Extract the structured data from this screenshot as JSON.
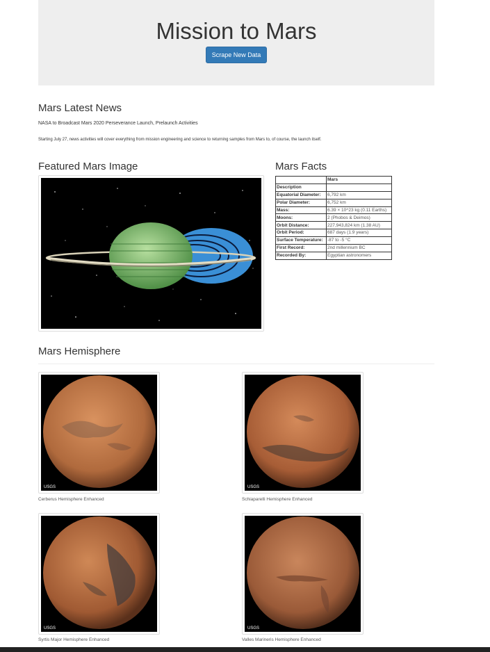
{
  "header": {
    "title": "Mission to Mars",
    "scrape_button_label": "Scrape New Data"
  },
  "news": {
    "heading": "Mars Latest News",
    "title": "NASA to Broadcast Mars 2020 Perseverance Launch, Prelaunch Activities",
    "paragraph": "Starting July 27, news activities will cover everything from mission engineering and science to returning samples from Mars to, of course, the launch itself."
  },
  "featured": {
    "heading": "Featured Mars Image"
  },
  "facts": {
    "heading": "Mars Facts",
    "column_header": "Mars",
    "description_label": "Description",
    "rows": [
      {
        "label": "Equatorial Diameter:",
        "value": "6,792 km"
      },
      {
        "label": "Polar Diameter:",
        "value": "6,752 km"
      },
      {
        "label": "Mass:",
        "value": "6.39 × 10^23 kg (0.11 Earths)"
      },
      {
        "label": "Moons:",
        "value": "2 (Phobos & Deimos)"
      },
      {
        "label": "Orbit Distance:",
        "value": "227,943,824 km (1.38 AU)"
      },
      {
        "label": "Orbit Period:",
        "value": "687 days (1.9 years)"
      },
      {
        "label": "Surface Temperature:",
        "value": "-87 to -5 °C"
      },
      {
        "label": "First Record:",
        "value": "2nd millennium BC"
      },
      {
        "label": "Recorded By:",
        "value": "Egyptian astronomers"
      }
    ]
  },
  "hemispheres": {
    "heading": "Mars Hemisphere",
    "items": [
      {
        "title": "Cerberus Hemisphere Enhanced"
      },
      {
        "title": "Schiaparelli Hemisphere Enhanced"
      },
      {
        "title": "Syrtis Major Hemisphere Enhanced"
      },
      {
        "title": "Valles Marineris Hemisphere Enhanced"
      }
    ],
    "image_logo_text": "USGS"
  }
}
